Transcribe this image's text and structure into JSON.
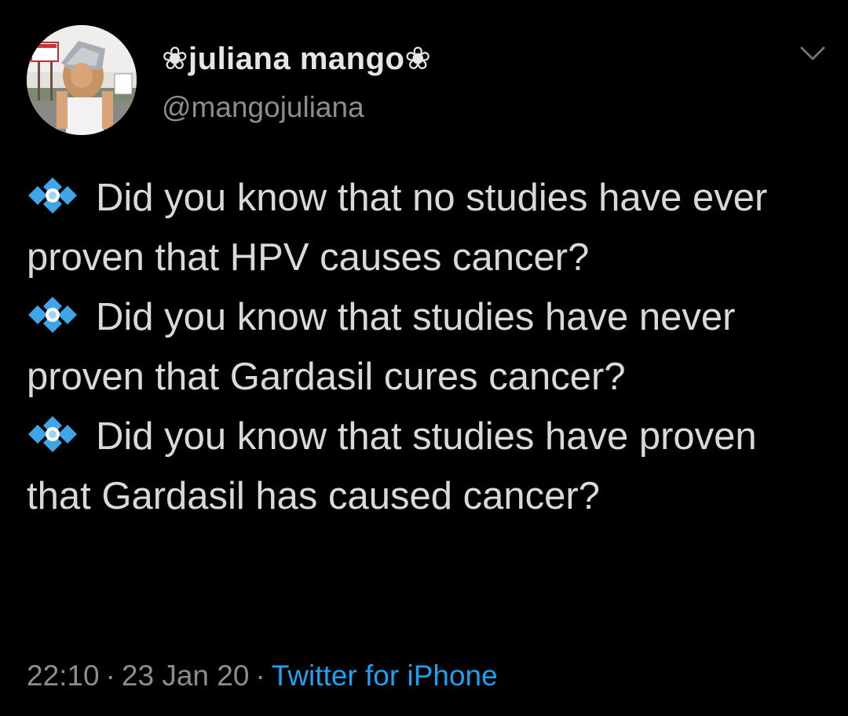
{
  "user": {
    "display_name": "❀juliana mango❀",
    "handle": "@mangojuliana",
    "avatar_icon": "profile-photo"
  },
  "menu": {
    "icon": "chevron-down-icon"
  },
  "tweet": {
    "bullet_icon": "blue-diamond-cluster-icon",
    "paragraphs": [
      {
        "text": "Did you know that no studies have ever proven that HPV causes cancer?"
      },
      {
        "text": "Did you know that studies have never proven that Gardasil cures cancer?"
      },
      {
        "text": "Did you know that studies have proven that Gardasil has caused cancer?"
      }
    ]
  },
  "meta": {
    "time": "22:10",
    "separator": "·",
    "date": "23 Jan 20",
    "source": "Twitter for iPhone"
  },
  "colors": {
    "background": "#000000",
    "text": "#d9d9d9",
    "secondary": "#8a8d91",
    "link": "#1da1f2",
    "bullet": "#3ea6e8"
  }
}
